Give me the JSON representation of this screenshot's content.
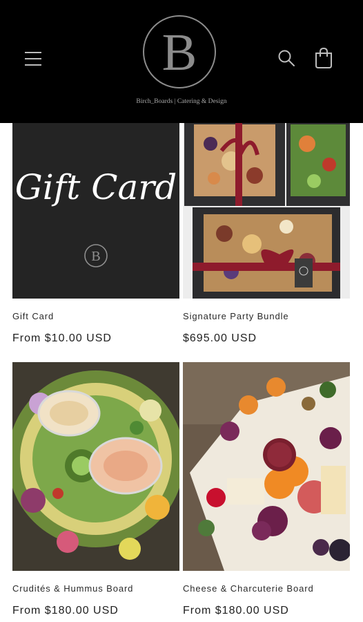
{
  "header": {
    "logo_letter": "B",
    "logo_text": "Birch_Boards | Catering & Design",
    "icons": [
      "menu-icon",
      "search-icon",
      "cart-icon"
    ],
    "background": "#000000"
  },
  "products": [
    {
      "title": "Gift Card",
      "price": "From $10.00 USD",
      "image_text": "Gift Card",
      "image_letter": "B"
    },
    {
      "title": "Signature Party Bundle",
      "price": "$695.00 USD"
    },
    {
      "title": "Crudités & Hummus Board",
      "price": "From $180.00 USD"
    },
    {
      "title": "Cheese & Charcuterie Board",
      "price": "From $180.00 USD"
    }
  ]
}
